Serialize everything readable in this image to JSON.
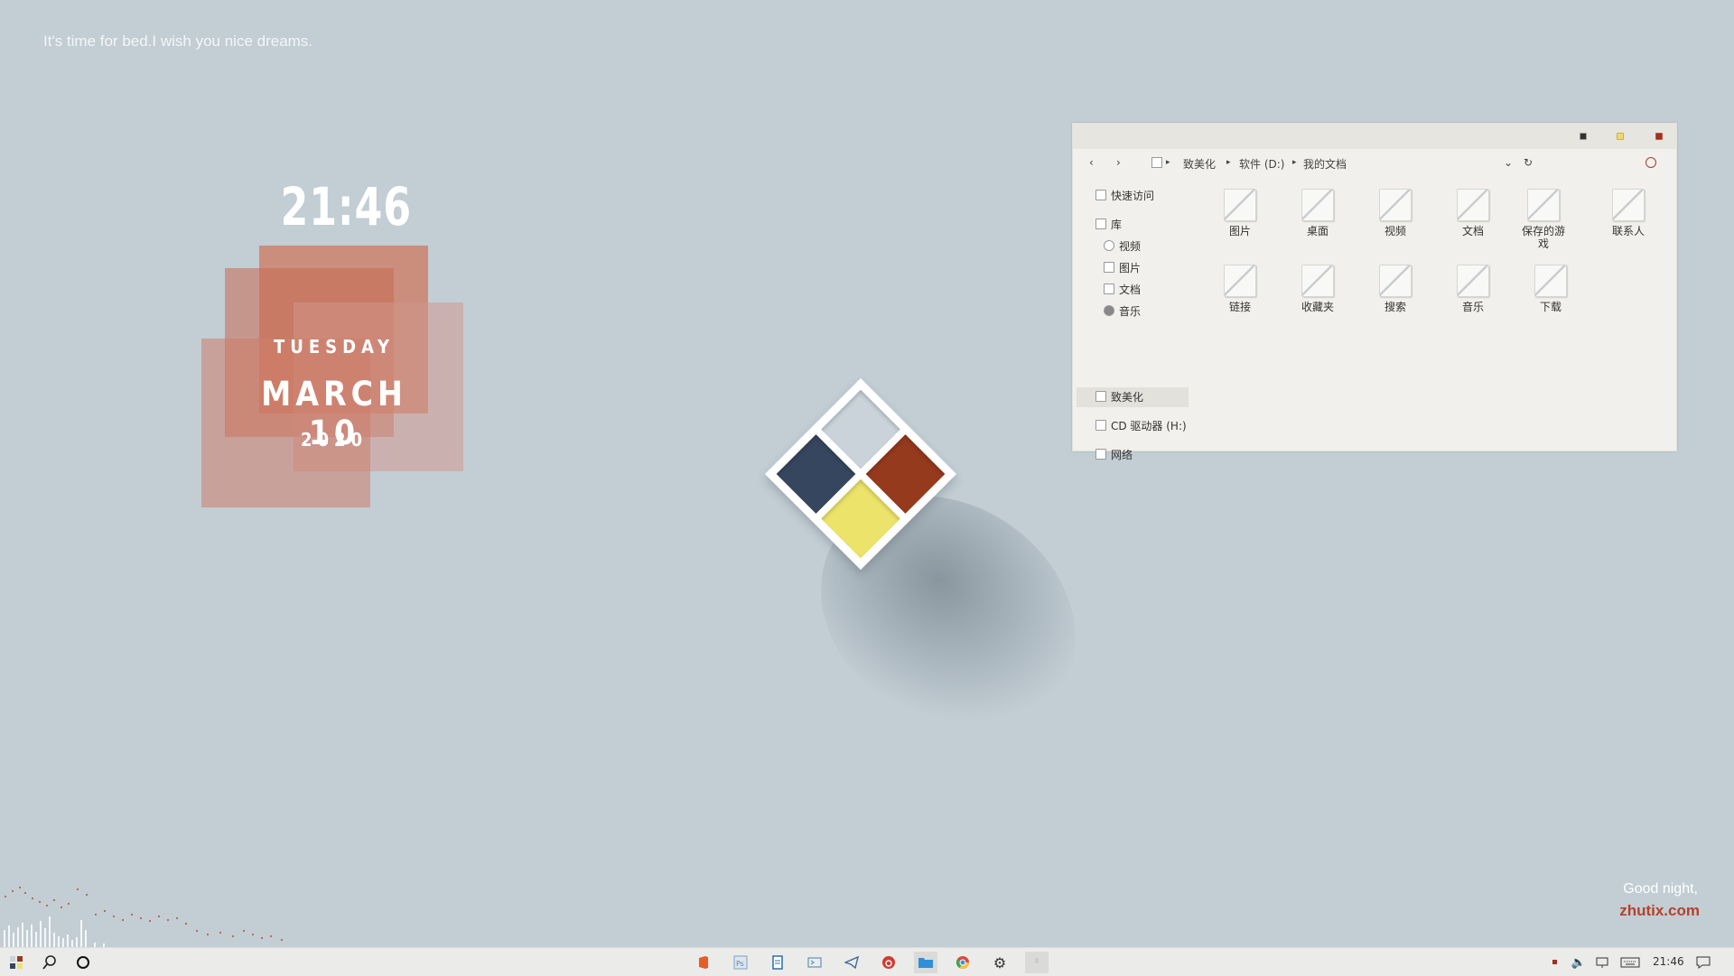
{
  "desktop": {
    "greeting": "It's time for bed.I wish you nice dreams.",
    "goodnight": "Good night,",
    "brand": "zhutix.com"
  },
  "clock_widget": {
    "time": "21:46",
    "day": "TUESDAY",
    "date": "MARCH 10",
    "year": "2020"
  },
  "logo": {
    "colors": {
      "top": "#c9d3d9",
      "right": "#963a1e",
      "left": "#36465e",
      "bottom": "#ece36a"
    }
  },
  "explorer": {
    "breadcrumb": [
      "致美化",
      "软件 (D:)",
      "我的文档"
    ],
    "nav": {
      "back": "‹",
      "forward": "›",
      "dropdown": "⌄",
      "refresh": "↻"
    },
    "sidebar": [
      {
        "label": "快速访问",
        "icon": "star-icon"
      },
      {
        "label": "库",
        "icon": "library-icon"
      },
      {
        "label": "视频",
        "icon": "video-icon"
      },
      {
        "label": "图片",
        "icon": "picture-icon"
      },
      {
        "label": "文档",
        "icon": "document-icon"
      },
      {
        "label": "音乐",
        "icon": "music-icon"
      },
      {
        "label": "致美化",
        "icon": "drive-icon",
        "selected": true
      },
      {
        "label": "CD 驱动器 (H:)",
        "icon": "cd-drive-icon"
      },
      {
        "label": "网络",
        "icon": "network-icon"
      }
    ],
    "files": [
      "图片",
      "桌面",
      "视频",
      "文档",
      "保存的游戏",
      "联系人",
      "链接",
      "收藏夹",
      "搜索",
      "音乐",
      "下载"
    ]
  },
  "taskbar": {
    "left_icons": [
      "start-icon",
      "search-icon",
      "cortana-icon"
    ],
    "apps": [
      "office-icon",
      "photoshop-icon",
      "notepad-icon",
      "terminal-icon",
      "telegram-icon",
      "netease-music-icon",
      "file-explorer-icon",
      "chrome-icon",
      "settings-icon",
      "unknown-app-icon"
    ],
    "tray_time": "21:46"
  },
  "accent_colors": {
    "brand": "#b8402a",
    "background": "#c2cdd4"
  }
}
